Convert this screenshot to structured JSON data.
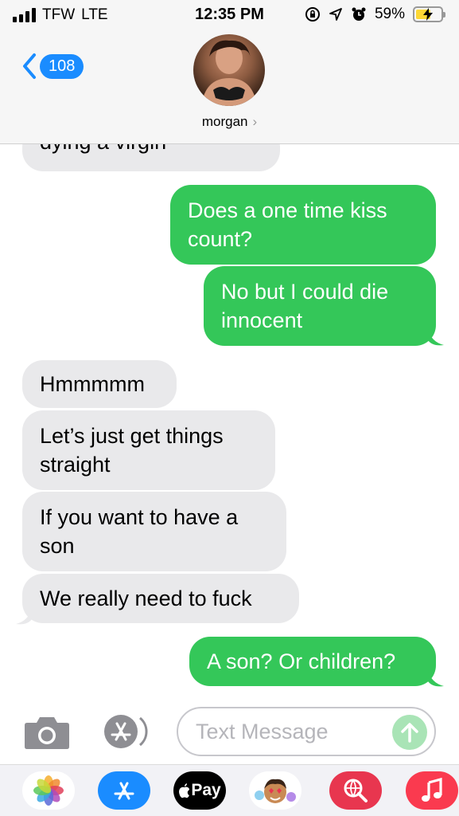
{
  "status_bar": {
    "carrier": "TFW",
    "network": "LTE",
    "time": "12:35 PM",
    "battery_percent": "59%",
    "battery_level": 0.59,
    "icons": [
      "signal-bars-icon",
      "orientation-lock-icon",
      "location-icon",
      "alarm-icon",
      "battery-charging-icon"
    ]
  },
  "header": {
    "back_count": "108",
    "contact_name": "morgan",
    "chevron": "›"
  },
  "messages": [
    {
      "direction": "incoming",
      "text": "dying a virgin"
    },
    {
      "direction": "outgoing",
      "text": "Does a one time kiss count?"
    },
    {
      "direction": "outgoing",
      "text": "No but I could die innocent"
    },
    {
      "direction": "incoming",
      "text": "Hmmmmm"
    },
    {
      "direction": "incoming",
      "text": "Let’s just get things straight"
    },
    {
      "direction": "incoming",
      "text": "If you want to have a son"
    },
    {
      "direction": "incoming",
      "text": "We really need to fuck"
    },
    {
      "direction": "outgoing",
      "text": "A son? Or children?"
    }
  ],
  "composer": {
    "placeholder": "Text Message",
    "value": ""
  },
  "app_drawer": {
    "apps": [
      {
        "name": "photos-app-icon"
      },
      {
        "name": "app-store-icon"
      },
      {
        "name": "apple-pay-icon",
        "label": "Pay"
      },
      {
        "name": "memoji-stickers-icon"
      },
      {
        "name": "web-search-icon"
      },
      {
        "name": "music-icon"
      }
    ]
  },
  "colors": {
    "incoming_bubble": "#e9e9eb",
    "outgoing_bubble": "#34c759",
    "accent": "#1a8cff"
  }
}
